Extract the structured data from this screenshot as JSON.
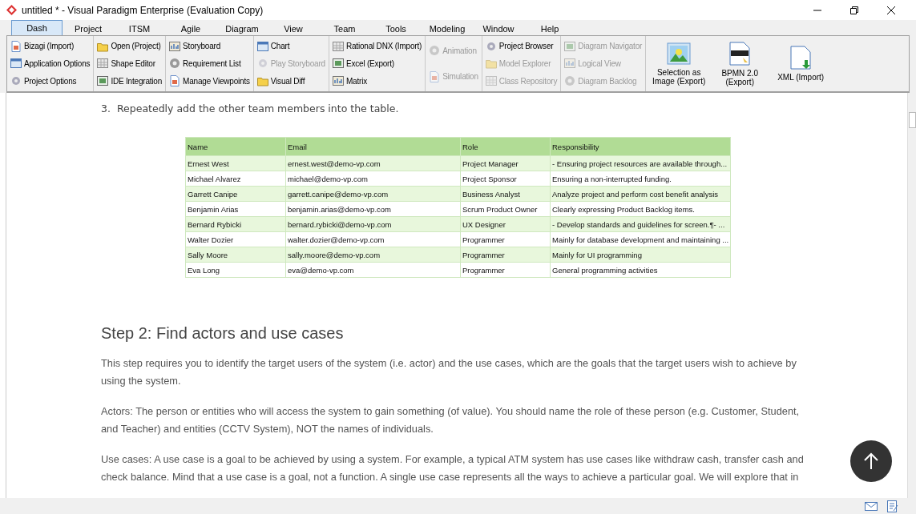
{
  "window": {
    "title": "untitled * - Visual Paradigm Enterprise (Evaluation Copy)"
  },
  "tabs": [
    {
      "label": "Dash",
      "selected": true
    },
    {
      "label": "Project",
      "selected": false
    },
    {
      "label": "ITSM",
      "selected": false
    },
    {
      "label": "Agile",
      "selected": false
    },
    {
      "label": "Diagram",
      "selected": false
    },
    {
      "label": "View",
      "selected": false
    },
    {
      "label": "Team",
      "selected": false
    },
    {
      "label": "Tools",
      "selected": false
    },
    {
      "label": "Modeling",
      "selected": false
    },
    {
      "label": "Window",
      "selected": false
    },
    {
      "label": "Help",
      "selected": false
    }
  ],
  "toolbar": {
    "groups": [
      [
        {
          "label": "Bizagi (Import)",
          "disabled": false
        },
        {
          "label": "Application Options",
          "disabled": false
        },
        {
          "label": "Project Options",
          "disabled": false
        }
      ],
      [
        {
          "label": "Open (Project)",
          "disabled": false
        },
        {
          "label": "Shape Editor",
          "disabled": false
        },
        {
          "label": "IDE Integration",
          "disabled": false
        }
      ],
      [
        {
          "label": "Storyboard",
          "disabled": false
        },
        {
          "label": "Requirement List",
          "disabled": false
        },
        {
          "label": "Manage Viewpoints",
          "disabled": false
        }
      ],
      [
        {
          "label": "Chart",
          "disabled": false
        },
        {
          "label": "Play Storyboard",
          "disabled": true
        },
        {
          "label": "Visual Diff",
          "disabled": false
        }
      ],
      [
        {
          "label": "Rational DNX (Import)",
          "disabled": false
        },
        {
          "label": "Excel (Export)",
          "disabled": false
        },
        {
          "label": "Matrix",
          "disabled": false
        }
      ],
      [
        {
          "label": "Animation",
          "disabled": true
        },
        {
          "label": "Simulation",
          "disabled": true
        }
      ],
      [
        {
          "label": "Project Browser",
          "disabled": false
        },
        {
          "label": "Model Explorer",
          "disabled": true
        },
        {
          "label": "Class Repository",
          "disabled": true
        }
      ],
      [
        {
          "label": "Diagram Navigator",
          "disabled": true
        },
        {
          "label": "Logical View",
          "disabled": true
        },
        {
          "label": "Diagram Backlog",
          "disabled": true
        }
      ]
    ],
    "large_buttons": [
      {
        "kind": "image",
        "label": "Selection as Image (Export)"
      },
      {
        "kind": "bpmn",
        "label": "BPMN 2.0 (Export)"
      },
      {
        "kind": "xml",
        "label": "XML (Import)"
      }
    ]
  },
  "document": {
    "list_item": {
      "number": "3.",
      "text": "Repeatedly add the other team members into the table."
    },
    "table": {
      "columns": [
        "Name",
        "Email",
        "Role",
        "Responsibility"
      ],
      "rows": [
        [
          "Ernest West",
          "ernest.west@demo-vp.com",
          "Project Manager",
          "- Ensuring project resources are available through..."
        ],
        [
          "Michael Alvarez",
          "michael@demo-vp.com",
          "Project Sponsor",
          "Ensuring a non-interrupted funding."
        ],
        [
          "Garrett Canipe",
          "garrett.canipe@demo-vp.com",
          "Business Analyst",
          "Analyze project and perform cost benefit analysis"
        ],
        [
          "Benjamin Arias",
          "benjamin.arias@demo-vp.com",
          "Scrum Product Owner",
          "Clearly expressing Product Backlog items."
        ],
        [
          "Bernard Rybicki",
          "bernard.rybicki@demo-vp.com",
          "UX Designer",
          "- Develop standards and guidelines for screen.¶- ..."
        ],
        [
          "Walter Dozier",
          "walter.dozier@demo-vp.com",
          "Programmer",
          "Mainly for database development and maintaining ..."
        ],
        [
          "Sally Moore",
          "sally.moore@demo-vp.com",
          "Programmer",
          "Mainly for UI programming"
        ],
        [
          "Eva Long",
          "eva@demo-vp.com",
          "Programmer",
          "General programming activities"
        ]
      ]
    },
    "heading": "Step 2: Find actors and use cases",
    "paragraphs": [
      "This step requires you to identify the target users of the system (i.e. actor) and the use cases, which are the goals that the target users wish to achieve by using the system.",
      "Actors: The person or entities who will access the system to gain something (of value). You should name the role of these person (e.g. Customer, Student, and Teacher) and entities (CCTV System), NOT the names of individuals.",
      "Use cases: A use case is a goal to be achieved by using a system. For example, a typical ATM system has use cases like withdraw cash, transfer cash and check balance. Mind that a use case is a goal, not a function. A single use case represents all the ways to achieve a particular goal. We will explore that in"
    ]
  }
}
